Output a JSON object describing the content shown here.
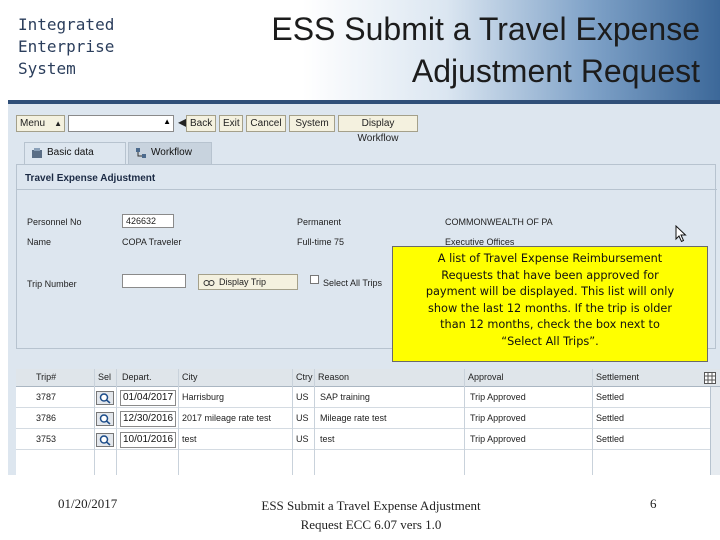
{
  "slide": {
    "org_lines": [
      "Integrated",
      "Enterprise",
      "System"
    ],
    "title_lines": [
      "ESS Submit a Travel Expense",
      "Adjustment Request"
    ]
  },
  "toolbar": {
    "menu_label": "Menu",
    "menu_dropdown_icon": "dropdown-triangle",
    "command_value": "",
    "nav_icon": "back-arrow-left",
    "buttons": [
      "Back",
      "Exit",
      "Cancel",
      "System",
      "Display Workflow"
    ]
  },
  "tabs": [
    {
      "label": "Basic data",
      "icon": "basic-data-icon",
      "active": true
    },
    {
      "label": "Workflow",
      "icon": "workflow-icon",
      "active": false
    }
  ],
  "form": {
    "title": "Travel Expense Adjustment",
    "personnel_no_label": "Personnel No",
    "personnel_no_value": "426632",
    "name_label": "Name",
    "name_value": "COPA Traveler",
    "permanent_label": "Permanent",
    "fulltime_label": "Full-time 75",
    "employer_value": "COMMONWEALTH OF PA",
    "org_value": "Executive Offices",
    "trip_number_label": "Trip Number",
    "trip_number_value": "",
    "display_trip_button": "Display Trip",
    "select_all_label": "Select All Trips",
    "select_all_checked": false
  },
  "callout": {
    "lines": [
      "A list of Travel Expense Reimbursement",
      "Requests that have been approved for",
      "payment will be displayed.  This list will only",
      "show the last 12 months.  If the trip is older",
      "than 12 months, check the box next to",
      "“Select All Trips”."
    ]
  },
  "grid": {
    "columns": [
      "Trip#",
      "Sel",
      "Depart.",
      "City",
      "Ctry",
      "Reason",
      "Approval",
      "Settlement"
    ],
    "rows": [
      {
        "trip": "3787",
        "depart": "01/04/2017",
        "city": "Harrisburg",
        "ctry": "US",
        "reason": "SAP training",
        "approval": "Trip Approved",
        "settlement": "Settled"
      },
      {
        "trip": "3786",
        "depart": "12/30/2016",
        "city": "2017 mileage rate test",
        "ctry": "US",
        "reason": "Mileage rate test",
        "approval": "Trip Approved",
        "settlement": "Settled"
      },
      {
        "trip": "3753",
        "depart": "10/01/2016",
        "city": "test",
        "ctry": "US",
        "reason": "test",
        "approval": "Trip Approved",
        "settlement": "Settled"
      }
    ]
  },
  "footer": {
    "date": "01/20/2017",
    "doc_lines": [
      "ESS Submit a Travel Expense Adjustment",
      "Request ECC 6.07 vers 1.0"
    ],
    "page": "6"
  },
  "colors": {
    "callout_bg": "#ffff00",
    "sap_bg": "#dde6ef",
    "header_accent": "#3c6899"
  }
}
